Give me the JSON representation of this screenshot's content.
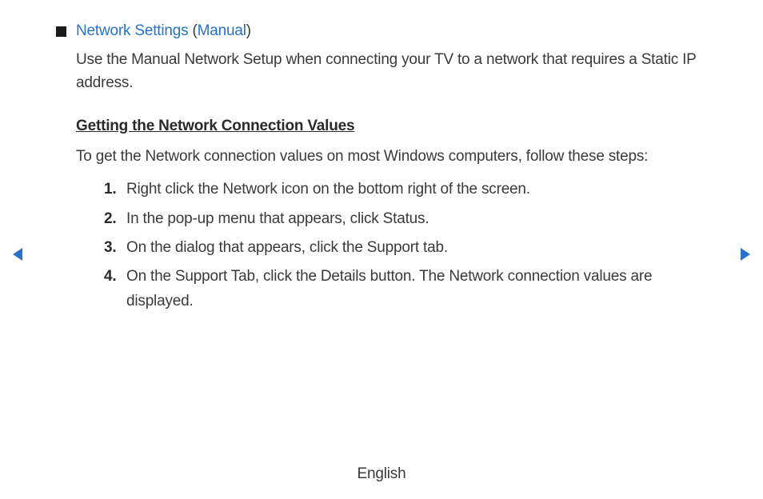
{
  "header": {
    "title_prefix": "Network Settings",
    "paren_open": " (",
    "title_inner": "Manual",
    "paren_close": ")"
  },
  "intro": "Use the Manual Network Setup when connecting your TV to a network that requires a Static IP address.",
  "subheading": "Getting the Network Connection Values",
  "subintro": "To get the Network connection values on most Windows computers, follow these steps:",
  "steps": [
    "Right click the Network icon on the bottom right of the screen.",
    "In the pop-up menu that appears, click Status.",
    "On the dialog that appears, click the Support tab.",
    "On the Support Tab, click the Details button. The Network connection values are displayed."
  ],
  "footer": "English"
}
